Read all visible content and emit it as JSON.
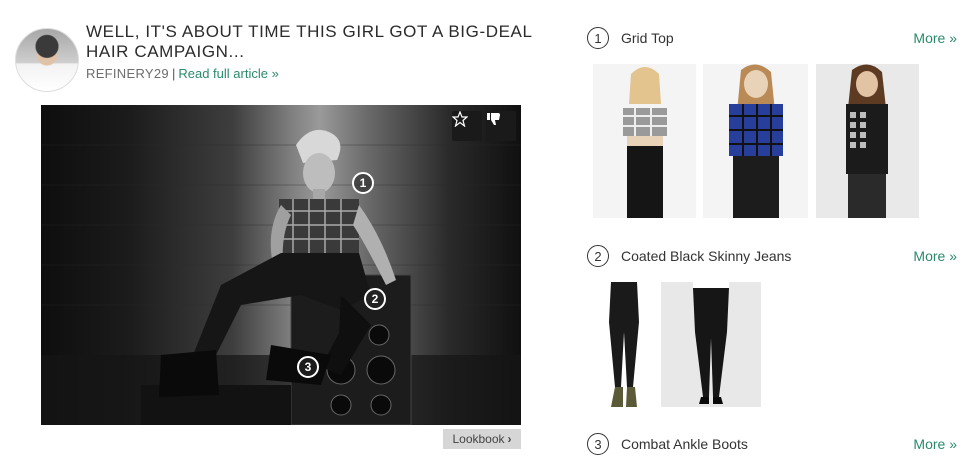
{
  "article": {
    "title": "WELL, IT'S ABOUT TIME THIS GIRL GOT A BIG-DEAL HAIR CAMPAIGN...",
    "source": "REFINERY29",
    "separator": "|",
    "read_link": "Read full article »"
  },
  "photo": {
    "hotspots": [
      "1",
      "2",
      "3"
    ],
    "lookbook_label": "Lookbook",
    "lookbook_chevron": "›"
  },
  "sections": [
    {
      "number": "1",
      "title": "Grid Top",
      "more": "More »"
    },
    {
      "number": "2",
      "title": "Coated Black Skinny Jeans",
      "more": "More »"
    },
    {
      "number": "3",
      "title": "Combat Ankle Boots",
      "more": "More »"
    }
  ],
  "colors": {
    "link": "#2a8a6a",
    "button_bg": "#1a1a1a",
    "lookbook_bg": "#d6d6d6"
  }
}
